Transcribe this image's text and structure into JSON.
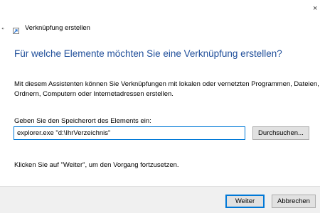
{
  "window": {
    "title": "Verknüpfung erstellen",
    "close_glyph": "×",
    "back_glyph": "←"
  },
  "page": {
    "heading": "Für welche Elemente möchten Sie eine Verknüpfung erstellen?",
    "description_line1": "Mit diesem Assistenten können Sie Verknüpfungen mit lokalen oder vernetzten Programmen, Dateien,",
    "description_line2": "Ordnern, Computern oder Internetadressen erstellen.",
    "location_label": "Geben Sie den Speicherort des Elements ein:",
    "location_value": "explorer.exe \"d:\\IhrVerzeichnis\"",
    "browse_label": "Durchsuchen...",
    "hint": "Klicken Sie auf \"Weiter\", um den Vorgang fortzusetzen."
  },
  "footer": {
    "next_label": "Weiter",
    "cancel_label": "Abbrechen"
  },
  "colors": {
    "heading": "#1f4e9a",
    "focus_border": "#0078d7",
    "footer_bg": "#f0f0f0",
    "button_bg": "#e1e1e1"
  },
  "icons": {
    "window": "shortcut-wizard-icon",
    "back": "back-arrow-icon",
    "close": "close-icon"
  }
}
